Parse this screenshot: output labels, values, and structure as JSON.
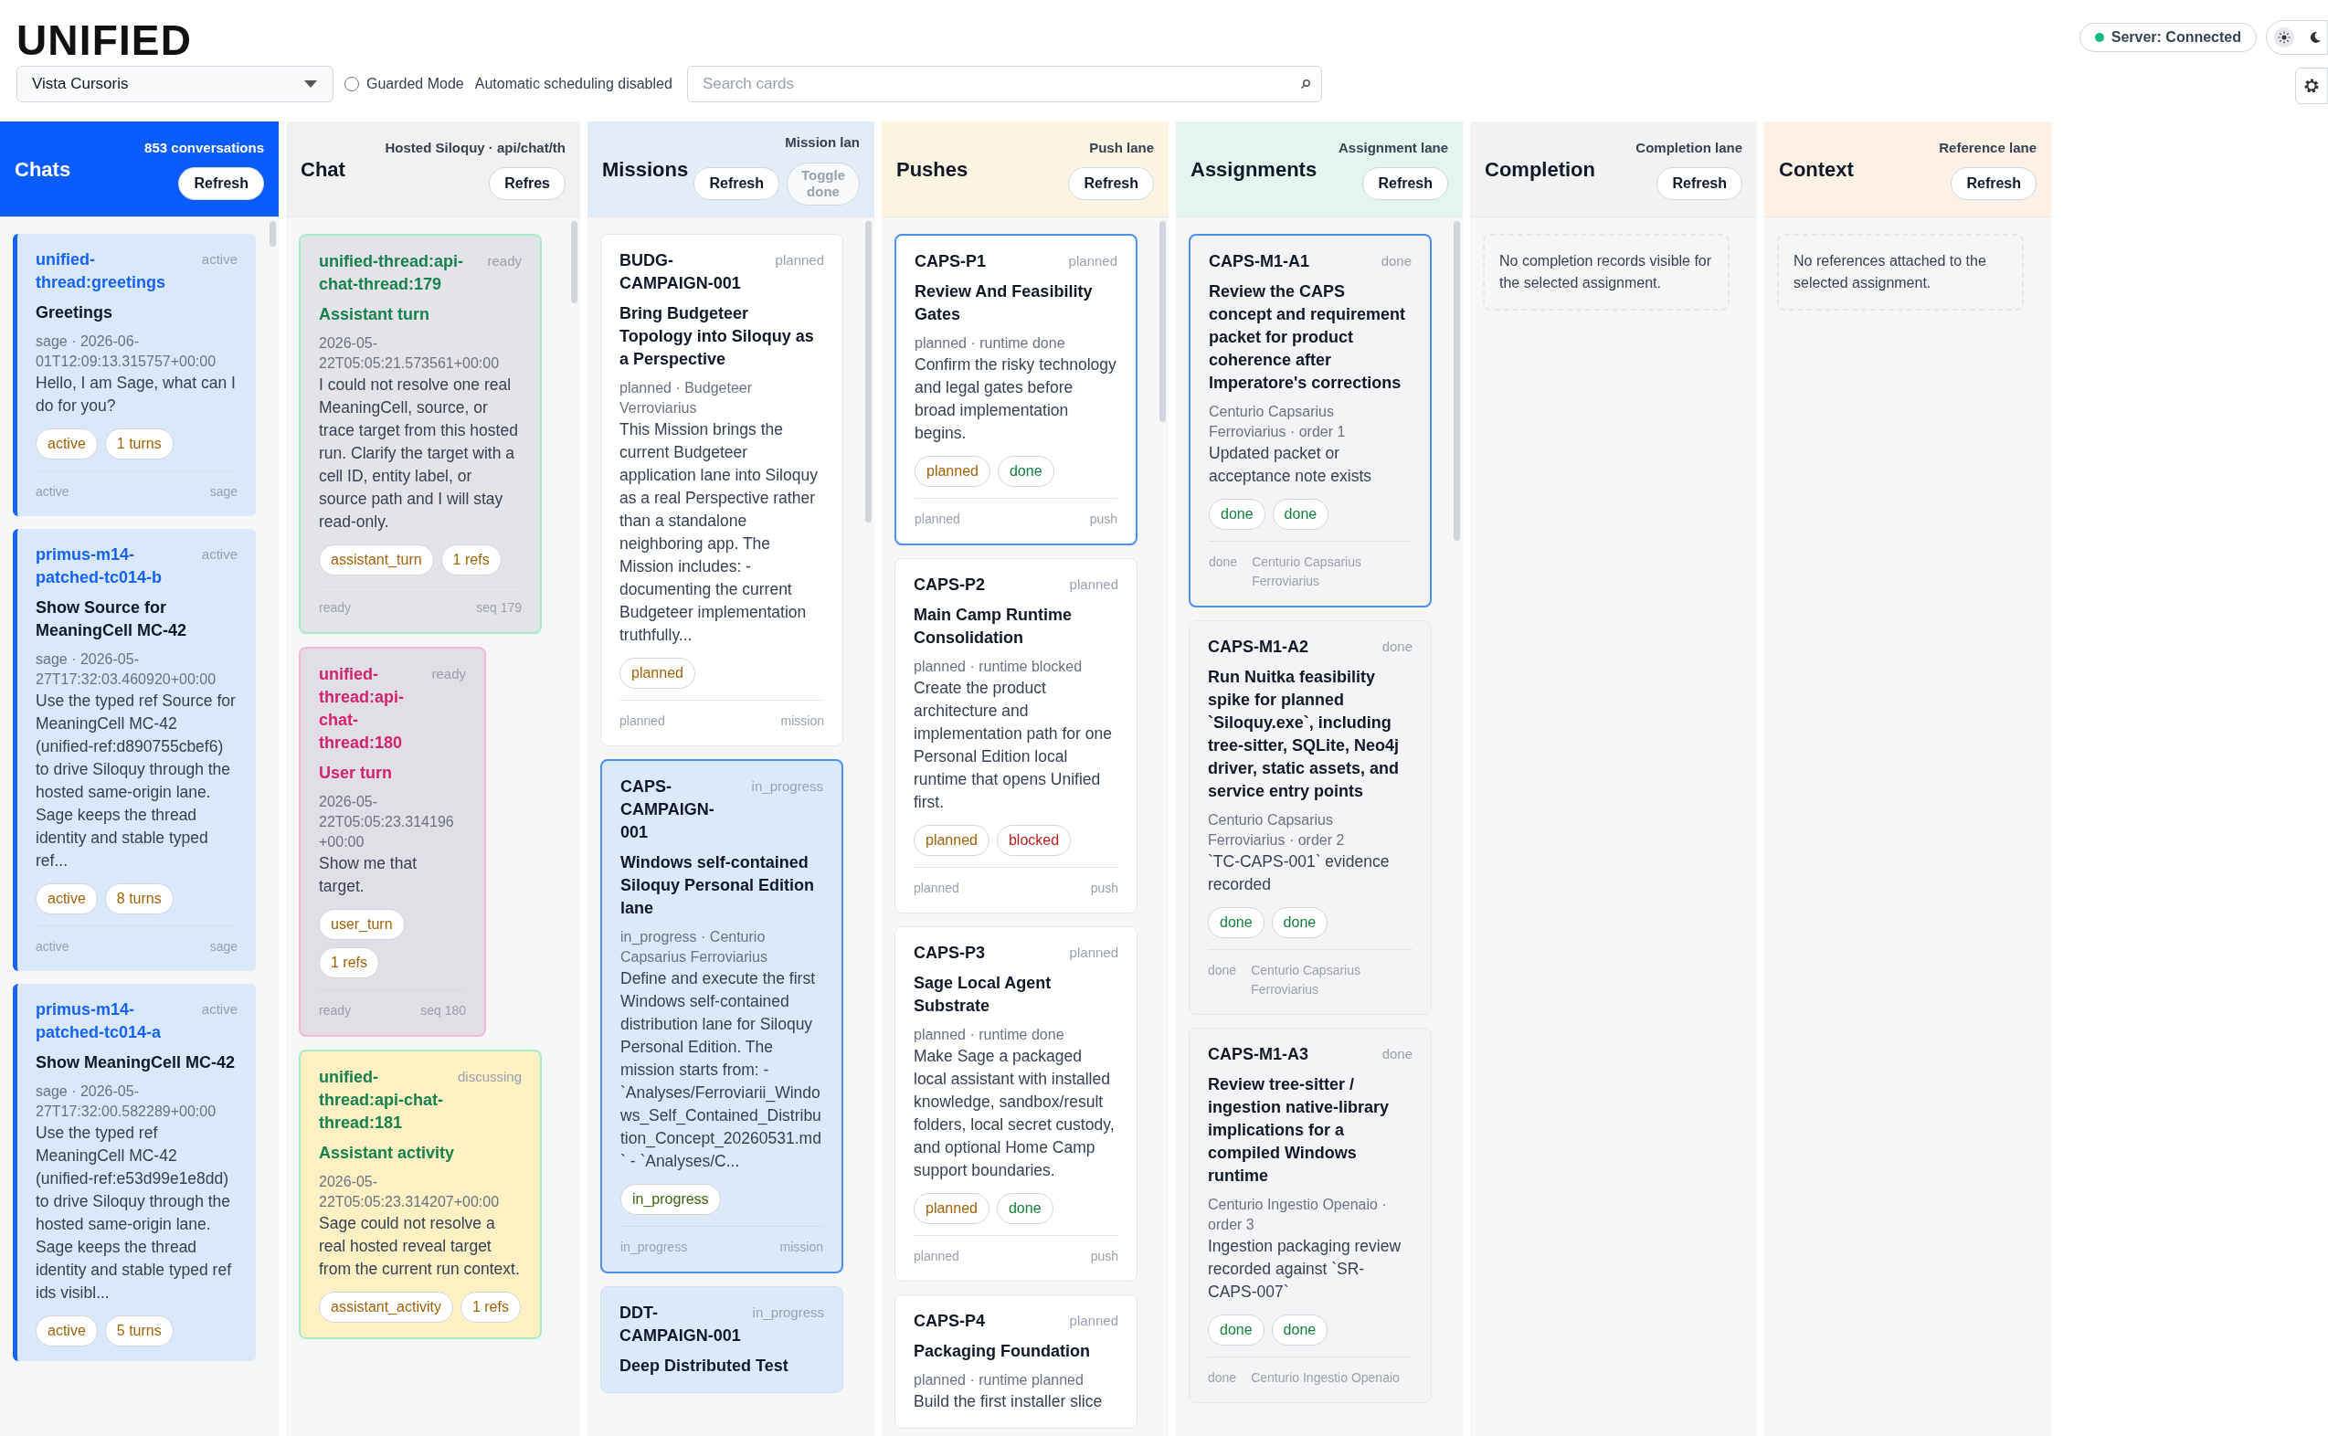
{
  "app_title": "UNIFIED",
  "toolbar": {
    "workspace": "Vista Cursoris",
    "guarded_mode": {
      "label": "Guarded Mode",
      "checked": false
    },
    "scheduling_note": "Automatic scheduling disabled",
    "search": {
      "placeholder": "Search cards"
    },
    "server_status": "Server: Connected",
    "theme_toggle": {
      "dark_mode": false
    }
  },
  "lanes": [
    {
      "kind": "chats",
      "title": "Chats",
      "subtitle": "853 conversations",
      "buttons": [
        "Refresh"
      ],
      "cards": [
        {
          "kind": "thread",
          "id": "unified-thread:greetings",
          "status": "active",
          "title": "Greetings",
          "meta": "sage · 2026-06-01T12:09:13.315757+00:00",
          "body": "Hello, I am Sage, what can I do for you?",
          "tags": [
            {
              "label": "active",
              "color": "#a16207"
            },
            {
              "label": "1 turns",
              "color": "#a16207"
            }
          ],
          "footer_left": "active",
          "footer_right": "sage"
        },
        {
          "kind": "thread",
          "id": "primus-m14-patched-tc014-b",
          "status": "active",
          "title": "Show Source for MeaningCell MC-42",
          "meta": "sage · 2026-05-27T17:32:03.460920+00:00",
          "body": "Use the typed ref Source for MeaningCell MC-42 (unified-ref:d890755cbef6) to drive Siloquy through the hosted same-origin lane. Sage keeps the thread identity and stable typed ref...",
          "tags": [
            {
              "label": "active",
              "color": "#a16207"
            },
            {
              "label": "8 turns",
              "color": "#a16207"
            }
          ],
          "footer_left": "active",
          "footer_right": "sage"
        },
        {
          "kind": "thread",
          "id": "primus-m14-patched-tc014-a",
          "status": "active",
          "title": "Show MeaningCell MC-42",
          "meta": "sage · 2026-05-27T17:32:00.582289+00:00",
          "body": "Use the typed ref MeaningCell MC-42 (unified-ref:e53d99e1e8dd) to drive Siloquy through the hosted same-origin lane. Sage keeps the thread identity and stable typed ref ids visibl...",
          "tags": [
            {
              "label": "active",
              "color": "#a16207"
            },
            {
              "label": "5 turns",
              "color": "#a16207"
            }
          ]
        }
      ]
    },
    {
      "kind": "chat",
      "title": "Chat",
      "subtitle": "Hosted Siloquy · api/chat/th",
      "buttons": [
        "Refres"
      ],
      "cards": [
        {
          "kind": "assistant_turn",
          "id": "unified-thread:api-chat-thread:179",
          "status": "ready",
          "title": "Assistant turn",
          "meta": "2026-05-22T05:05:21.573561+00:00",
          "body": "I could not resolve one real MeaningCell, source, or trace target from this hosted run. Clarify the target with a cell ID, entity label, or source path and I will stay read-only.",
          "tags": [
            {
              "label": "assistant_turn",
              "color": "#a16207"
            },
            {
              "label": "1 refs",
              "color": "#a16207"
            }
          ],
          "footer_left": "ready",
          "footer_right": "seq 179"
        },
        {
          "kind": "user_turn",
          "id": "unified-thread:api-chat-thread:180",
          "status": "ready",
          "title": "User turn",
          "meta": "2026-05-22T05:05:23.314196 +00:00",
          "body": "Show me that target.",
          "tags": [
            {
              "label": "user_turn",
              "color": "#a16207"
            },
            {
              "label": "1 refs",
              "color": "#a16207"
            }
          ],
          "footer_left": "ready",
          "footer_right": "seq 180"
        },
        {
          "kind": "assistant_activity",
          "id": "unified-thread:api-chat-thread:181",
          "status": "discussing",
          "title": "Assistant activity",
          "meta": "2026-05-22T05:05:23.314207+00:00",
          "body": "Sage could not resolve a real hosted reveal target from the current run context.",
          "tags": [
            {
              "label": "assistant_activity",
              "color": "#a16207"
            },
            {
              "label": "1 refs",
              "color": "#a16207"
            }
          ]
        }
      ]
    },
    {
      "kind": "missions",
      "title": "Missions",
      "subtitle": "Mission lan",
      "buttons": [
        "Refresh",
        "Toggle done"
      ],
      "cards": [
        {
          "kind": "open_item",
          "selected": false,
          "id": "BUDG-CAMPAIGN-001",
          "status": "planned",
          "title": "Bring Budgeteer Topology into Siloquy as a Perspective",
          "meta": "planned · Budgeteer Verroviarius",
          "body": "This Mission brings the current Budgeteer application lane into Siloquy as a real Perspective rather than a standalone neighboring app. The Mission includes: - documenting the current Budgeteer implementation truthfully...",
          "tags": [
            {
              "label": "planned",
              "color": "#a16207"
            }
          ],
          "footer_left": "planned",
          "footer_right": "mission"
        },
        {
          "kind": "active_item",
          "selected": true,
          "id": "CAPS-CAMPAIGN-001",
          "status": "in_progress",
          "title": "Windows self-contained Siloquy Personal Edition lane",
          "meta": "in_progress · Centurio Capsarius Ferroviarius",
          "body": "Define and execute the first Windows self-contained distribution lane for Siloquy Personal Edition. The mission starts from: - `Analyses/Ferroviarii_Windows_Self_Contained_Distribution_Concept_20260531.md` - `Analyses/C...",
          "tags": [
            {
              "label": "in_progress",
              "color": "#3f6212"
            }
          ],
          "footer_left": "in_progress",
          "footer_right": "mission"
        },
        {
          "kind": "active_item",
          "selected": false,
          "id": "DDT-CAMPAIGN-001",
          "status": "in_progress",
          "title": "Deep Distributed Test"
        }
      ]
    },
    {
      "kind": "pushes",
      "title": "Pushes",
      "subtitle": "Push lane",
      "buttons": [
        "Refresh"
      ],
      "cards": [
        {
          "kind": "open_item",
          "selected": true,
          "id": "CAPS-P1",
          "status": "planned",
          "title": "Review And Feasibility Gates",
          "meta": "planned · runtime done",
          "body": "Confirm the risky technology and legal gates before broad implementation begins.",
          "tags": [
            {
              "label": "planned",
              "color": "#a16207"
            },
            {
              "label": "done",
              "color": "#15803d"
            }
          ],
          "footer_left": "planned",
          "footer_right": "push"
        },
        {
          "kind": "open_item",
          "selected": false,
          "id": "CAPS-P2",
          "status": "planned",
          "title": "Main Camp Runtime Consolidation",
          "meta": "planned · runtime blocked",
          "body": "Create the product architecture and implementation path for one Personal Edition local runtime that opens Unified first.",
          "tags": [
            {
              "label": "planned",
              "color": "#a16207"
            },
            {
              "label": "blocked",
              "color": "#b91c1c"
            }
          ],
          "footer_left": "planned",
          "footer_right": "push"
        },
        {
          "kind": "open_item",
          "selected": false,
          "id": "CAPS-P3",
          "status": "planned",
          "title": "Sage Local Agent Substrate",
          "meta": "planned · runtime done",
          "body": "Make Sage a packaged local assistant with installed knowledge, sandbox/result folders, local secret custody, and optional Home Camp support boundaries.",
          "tags": [
            {
              "label": "planned",
              "color": "#a16207"
            },
            {
              "label": "done",
              "color": "#15803d"
            }
          ],
          "footer_left": "planned",
          "footer_right": "push"
        },
        {
          "kind": "open_item",
          "selected": false,
          "id": "CAPS-P4",
          "status": "planned",
          "title": "Packaging Foundation",
          "meta": "planned · runtime planned",
          "body": "Build the first installer slice"
        }
      ]
    },
    {
      "kind": "assignments",
      "title": "Assignments",
      "subtitle": "Assignment lane",
      "buttons": [
        "Refresh"
      ],
      "cards": [
        {
          "kind": "closed_item",
          "selected": true,
          "id": "CAPS-M1-A1",
          "status": "done",
          "title": "Review the CAPS concept and requirement packet for product coherence after Imperatore's corrections",
          "meta": "Centurio Capsarius Ferroviarius · order 1",
          "body": "Updated packet or acceptance note exists",
          "tags": [
            {
              "label": "done",
              "color": "#15803d"
            },
            {
              "label": "done",
              "color": "#15803d"
            }
          ],
          "footer_left": "done",
          "footer_right": "Centurio Capsarius Ferroviarius"
        },
        {
          "kind": "closed_item",
          "selected": false,
          "id": "CAPS-M1-A2",
          "status": "done",
          "title": "Run Nuitka feasibility spike for planned `Siloquy.exe`, including tree-sitter, SQLite, Neo4j driver, static assets, and service entry points",
          "meta": "Centurio Capsarius Ferroviarius · order 2",
          "body": "`TC-CAPS-001` evidence recorded",
          "tags": [
            {
              "label": "done",
              "color": "#15803d"
            },
            {
              "label": "done",
              "color": "#15803d"
            }
          ],
          "footer_left": "done",
          "footer_right": "Centurio Capsarius Ferroviarius"
        },
        {
          "kind": "closed_item",
          "selected": false,
          "id": "CAPS-M1-A3",
          "status": "done",
          "title": "Review tree-sitter / ingestion native-library implications for a compiled Windows runtime",
          "meta": "Centurio Ingestio Openaio · order 3",
          "body": "Ingestion packaging review recorded against `SR-CAPS-007`",
          "tags": [
            {
              "label": "done",
              "color": "#15803d"
            },
            {
              "label": "done",
              "color": "#15803d"
            }
          ],
          "footer_left": "done",
          "footer_right": "Centurio Ingestio Openaio"
        }
      ]
    },
    {
      "kind": "completion",
      "title": "Completion",
      "subtitle": "Completion lane",
      "buttons": [
        "Refresh"
      ],
      "empty_note": "No completion records visible for the selected assignment."
    },
    {
      "kind": "context",
      "title": "Context",
      "subtitle": "Reference lane",
      "buttons": [
        "Refresh"
      ],
      "empty_note": "No references attached to the selected assignment."
    }
  ]
}
